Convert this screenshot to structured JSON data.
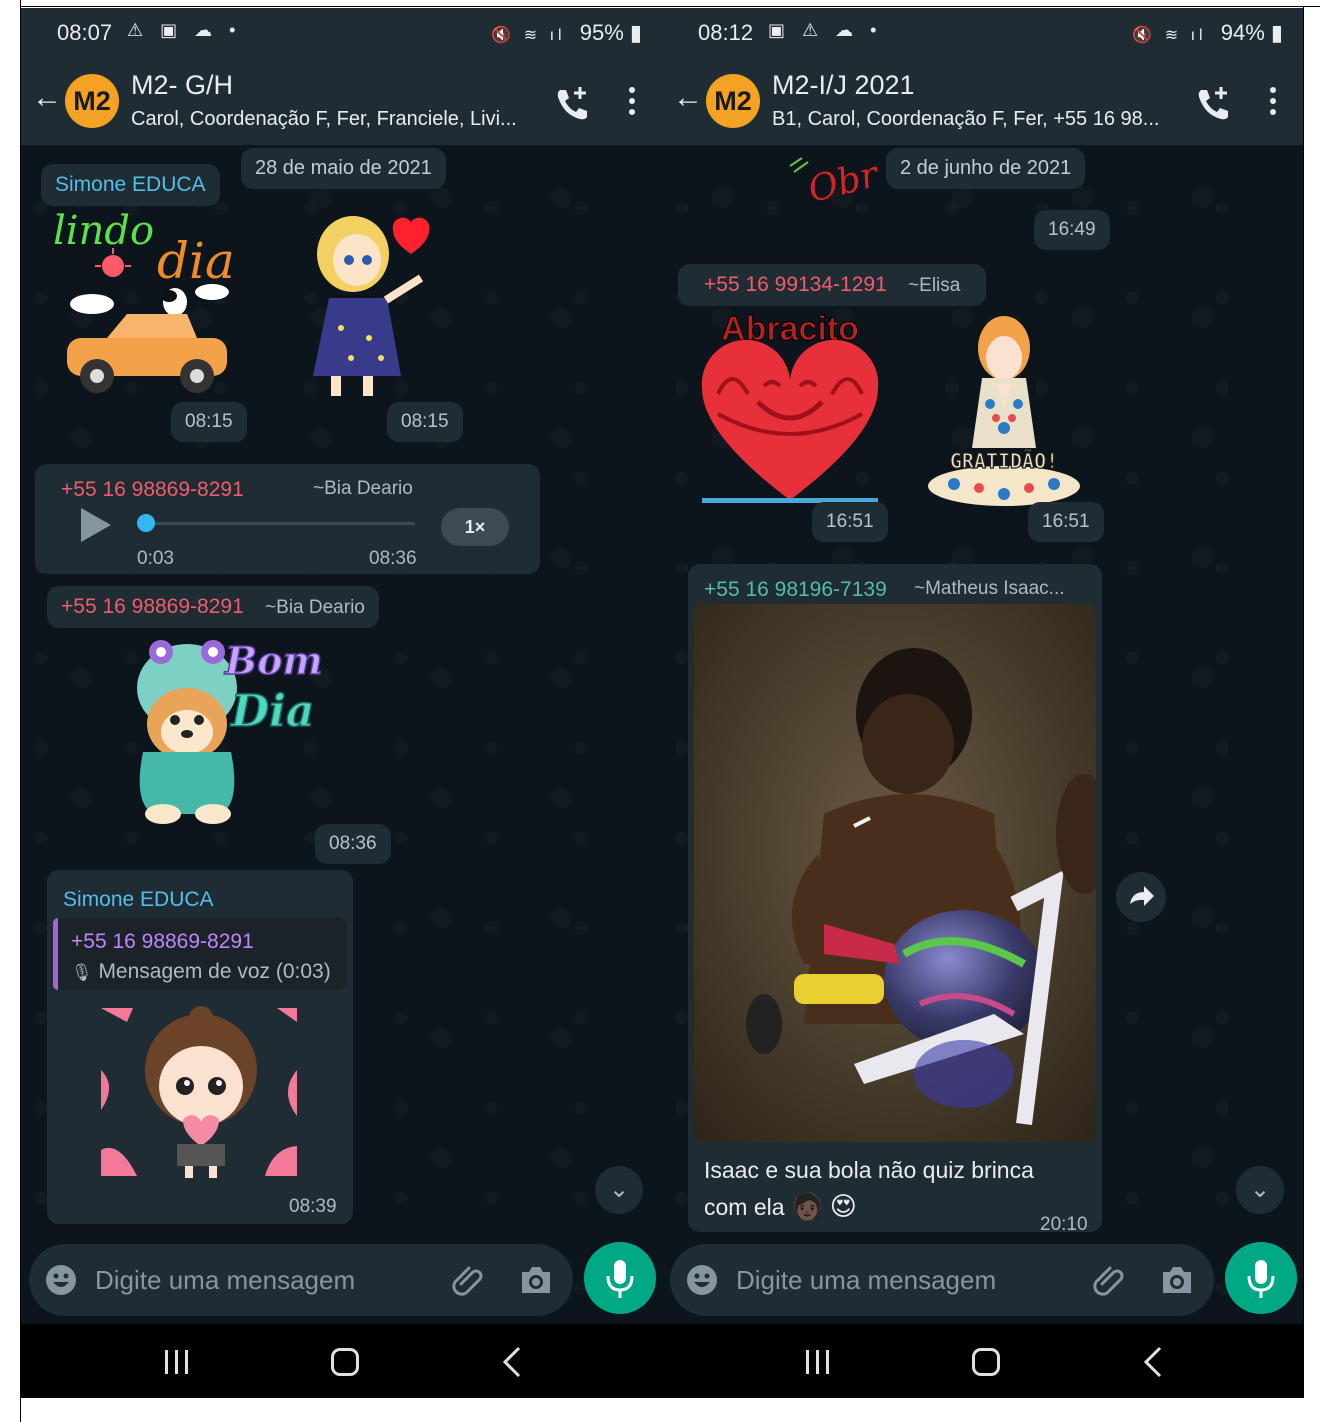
{
  "left": {
    "status": {
      "time": "08:07",
      "battery": "95%"
    },
    "header": {
      "avatar": "M2",
      "title": "M2- G/H",
      "subtitle": "Carol, Coordenação F, Fer, Franciele, Livi..."
    },
    "date_label": "28 de maio de 2021",
    "messages": [
      {
        "sender": "Simone EDUCA",
        "sticker_text": "lindo dia",
        "time": "08:15"
      },
      {
        "time": "08:15"
      },
      {
        "sender": "+55 16 98869-8291",
        "pushname": "~Bia Deario",
        "audio_duration": "0:03",
        "audio_speed": "1×",
        "time": "08:36"
      },
      {
        "sender": "+55 16 98869-8291",
        "pushname": "~Bia Deario",
        "sticker_text": "Bom Dia",
        "time": "08:36"
      },
      {
        "sender": "Simone EDUCA",
        "quote_sender": "+55 16 98869-8291",
        "quote_text": "Mensagem de voz (0:03)",
        "time": "08:39"
      }
    ],
    "composer": {
      "placeholder": "Digite uma mensagem"
    }
  },
  "right": {
    "status": {
      "time": "08:12",
      "battery": "94%"
    },
    "header": {
      "avatar": "M2",
      "title": "M2-I/J 2021",
      "subtitle": "B1, Carol, Coordenação F, Fer, +55 16 98..."
    },
    "date_label": "2 de junho de 2021",
    "partial_sticker_text": "Obr",
    "messages": [
      {
        "time": "16:49"
      },
      {
        "sender": "+55 16 99134-1291",
        "pushname": "~Elisa",
        "sticker_text": "Abracito",
        "time": "16:51"
      },
      {
        "sticker_text": "GRATIDÃO!",
        "time": "16:51"
      },
      {
        "sender": "+55 16 98196-7139",
        "pushname": "~Matheus Isaac...",
        "caption_line1": "Isaac e sua bola não quiz brinca",
        "caption_line2": "com ela",
        "time": "20:10"
      }
    ],
    "composer": {
      "placeholder": "Digite uma mensagem"
    }
  },
  "icons": {
    "back": "back-arrow-icon",
    "call": "add-call-icon",
    "menu": "more-vert-icon",
    "emoji": "emoji-icon",
    "attach": "paperclip-icon",
    "camera": "camera-icon",
    "mic": "mic-icon",
    "scroll": "chevron-double-down-icon",
    "forward": "forward-icon"
  },
  "colors": {
    "accent": "#00a884",
    "background": "#0c151b",
    "bubble": "#202c33",
    "avatar": "#f4a223",
    "sender_blue": "#53bdeb",
    "sender_pink": "#f15c6d",
    "sender_green": "#53bdab"
  }
}
